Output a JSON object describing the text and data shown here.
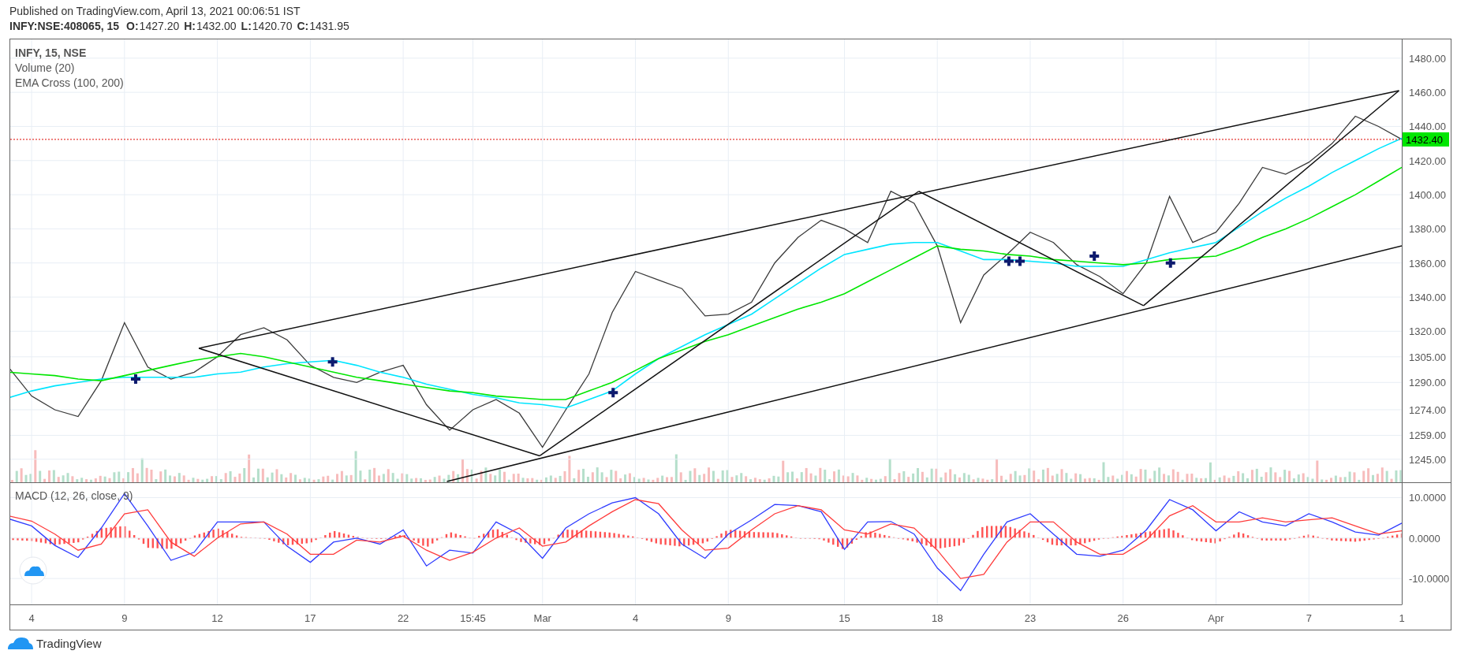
{
  "header": {
    "published": "Published on TradingView.com, April 13, 2021 00:06:51 IST",
    "symbol": "INFY:NSE:408065, 15",
    "ohlc": [
      {
        "label": "O:",
        "value": "1427.20"
      },
      {
        "label": "H:",
        "value": "1432.00"
      },
      {
        "label": "L:",
        "value": "1420.70"
      },
      {
        "label": "C:",
        "value": "1431.95"
      }
    ]
  },
  "price_pane": {
    "legend": {
      "title": "INFY, 15, NSE",
      "studies": [
        "Volume (20)",
        "EMA Cross (100, 200)"
      ]
    },
    "last_price_label": "1432.40",
    "chart_data": {
      "type": "line",
      "grid": true,
      "ylim": [
        1231.5,
        1491
      ],
      "yticks": [
        {
          "value": 1480,
          "label": "1480.00"
        },
        {
          "value": 1460,
          "label": "1460.00"
        },
        {
          "value": 1440,
          "label": "1440.00"
        },
        {
          "value": 1420,
          "label": "1420.00"
        },
        {
          "value": 1400,
          "label": "1400.00"
        },
        {
          "value": 1380,
          "label": "1380.00"
        },
        {
          "value": 1360,
          "label": "1360.00"
        },
        {
          "value": 1340,
          "label": "1340.00"
        },
        {
          "value": 1320,
          "label": "1320.00"
        },
        {
          "value": 1305,
          "label": "1305.00"
        },
        {
          "value": 1290,
          "label": "1290.00"
        },
        {
          "value": 1274,
          "label": "1274.00"
        },
        {
          "value": 1259,
          "label": "1259.00"
        },
        {
          "value": 1245,
          "label": "1245.00"
        }
      ],
      "series": [
        {
          "color": "#3a3a3a",
          "values": [
            1299,
            1282,
            1274,
            1270,
            1291,
            1325,
            1299,
            1292,
            1296,
            1305,
            1318,
            1322,
            1315,
            1300,
            1293,
            1290,
            1296,
            1300,
            1277,
            1262,
            1274,
            1280,
            1272,
            1252,
            1274,
            1295,
            1331,
            1355,
            1350,
            1345,
            1329,
            1330,
            1337,
            1360,
            1375,
            1385,
            1380,
            1372,
            1402,
            1395,
            1370,
            1325,
            1353,
            1365,
            1378,
            1372,
            1359,
            1352,
            1342,
            1360,
            1399,
            1372,
            1378,
            1395,
            1416,
            1412,
            1419,
            1430,
            1446,
            1440,
            1432.4
          ]
        },
        {
          "color": "#00e5ff",
          "values": [
            1281,
            1285,
            1288,
            1290,
            1292,
            1293,
            1293,
            1293,
            1293,
            1295,
            1296,
            1299,
            1301,
            1302,
            1303,
            1300,
            1296,
            1293,
            1289,
            1286,
            1283,
            1281,
            1278,
            1277,
            1275,
            1280,
            1285,
            1295,
            1304,
            1311,
            1318,
            1324,
            1330,
            1339,
            1348,
            1357,
            1365,
            1368,
            1371,
            1372,
            1372,
            1367,
            1362,
            1362,
            1361,
            1360,
            1358,
            1358,
            1358,
            1362,
            1366,
            1369,
            1372,
            1381,
            1390,
            1398,
            1405,
            1413,
            1420,
            1427,
            1433
          ]
        },
        {
          "color": "#00e600",
          "values": [
            1296,
            1295,
            1294,
            1292,
            1291,
            1294,
            1297,
            1300,
            1303,
            1305,
            1307,
            1305,
            1302,
            1299,
            1296,
            1293,
            1291,
            1289,
            1287,
            1285,
            1284,
            1282,
            1281,
            1280,
            1280,
            1285,
            1290,
            1297,
            1304,
            1309,
            1314,
            1318,
            1323,
            1328,
            1333,
            1337,
            1342,
            1349,
            1356,
            1363,
            1370,
            1368,
            1367,
            1365,
            1364,
            1362,
            1361,
            1360,
            1359,
            1360,
            1362,
            1363,
            1364,
            1369,
            1375,
            1380,
            1386,
            1393,
            1400,
            1408,
            1416
          ]
        }
      ]
    }
  },
  "macd_pane": {
    "legend": "MACD (12, 26, close, 9)",
    "chart_data": {
      "type": "line",
      "grid": true,
      "ylim": [
        -16.4,
        13.6
      ],
      "categories": [
        null,
        "4",
        null,
        null,
        null,
        "9",
        null,
        null,
        null,
        "12",
        null,
        null,
        null,
        "17",
        null,
        null,
        null,
        "22",
        null,
        null,
        "15:45",
        null,
        null,
        "Mar",
        null,
        null,
        null,
        "4",
        null,
        null,
        null,
        "9",
        null,
        null,
        null,
        null,
        "15",
        null,
        null,
        null,
        "18",
        null,
        null,
        null,
        "23",
        null,
        null,
        null,
        "26",
        null,
        null,
        null,
        "Apr",
        null,
        null,
        null,
        "7",
        null,
        null,
        null,
        "1"
      ],
      "yticks": [
        {
          "value": 10,
          "label": "10.0000"
        },
        {
          "value": 0,
          "label": "0.0000"
        },
        {
          "value": -10,
          "label": "-10.0000"
        }
      ],
      "series": [
        {
          "color": "#2f3cff",
          "values": [
            4.8,
            3,
            -1.8,
            -4.8,
            2.5,
            11,
            3,
            -5.5,
            -3.5,
            4,
            4,
            4,
            -2,
            -6,
            -1,
            0,
            -1.5,
            2,
            -6.9,
            -3,
            -3.7,
            4,
            1,
            -5,
            2.5,
            6,
            8.7,
            10,
            6,
            -1.5,
            -5,
            1,
            4.5,
            8.3,
            8,
            6.5,
            -2.8,
            4,
            4.1,
            1,
            -7.4,
            -13,
            -4,
            4,
            6,
            1,
            -4,
            -4.5,
            -3,
            2,
            9.5,
            7,
            1.8,
            6.5,
            4,
            3,
            6,
            4,
            1.5,
            0.7,
            3.7
          ]
        },
        {
          "color": "#ff3b3b",
          "values": [
            5.5,
            4.2,
            1,
            -3,
            -1.5,
            6,
            7,
            -1,
            -4.5,
            0,
            3.5,
            4,
            1,
            -4,
            -4,
            -0.5,
            -1,
            0.5,
            -3,
            -5.5,
            -3.5,
            0,
            2.5,
            -2,
            -1,
            3,
            6.5,
            9.5,
            8.5,
            2,
            -3,
            -2.5,
            2,
            6,
            8,
            7,
            2,
            1,
            3.5,
            2.5,
            -3,
            -10,
            -9,
            -1,
            4,
            4,
            -1,
            -4,
            -4,
            -0.5,
            5.5,
            8,
            4,
            4,
            5,
            4,
            4.5,
            5,
            3,
            1,
            1.8
          ]
        }
      ]
    }
  },
  "footer": {
    "brand": "TradingView"
  }
}
